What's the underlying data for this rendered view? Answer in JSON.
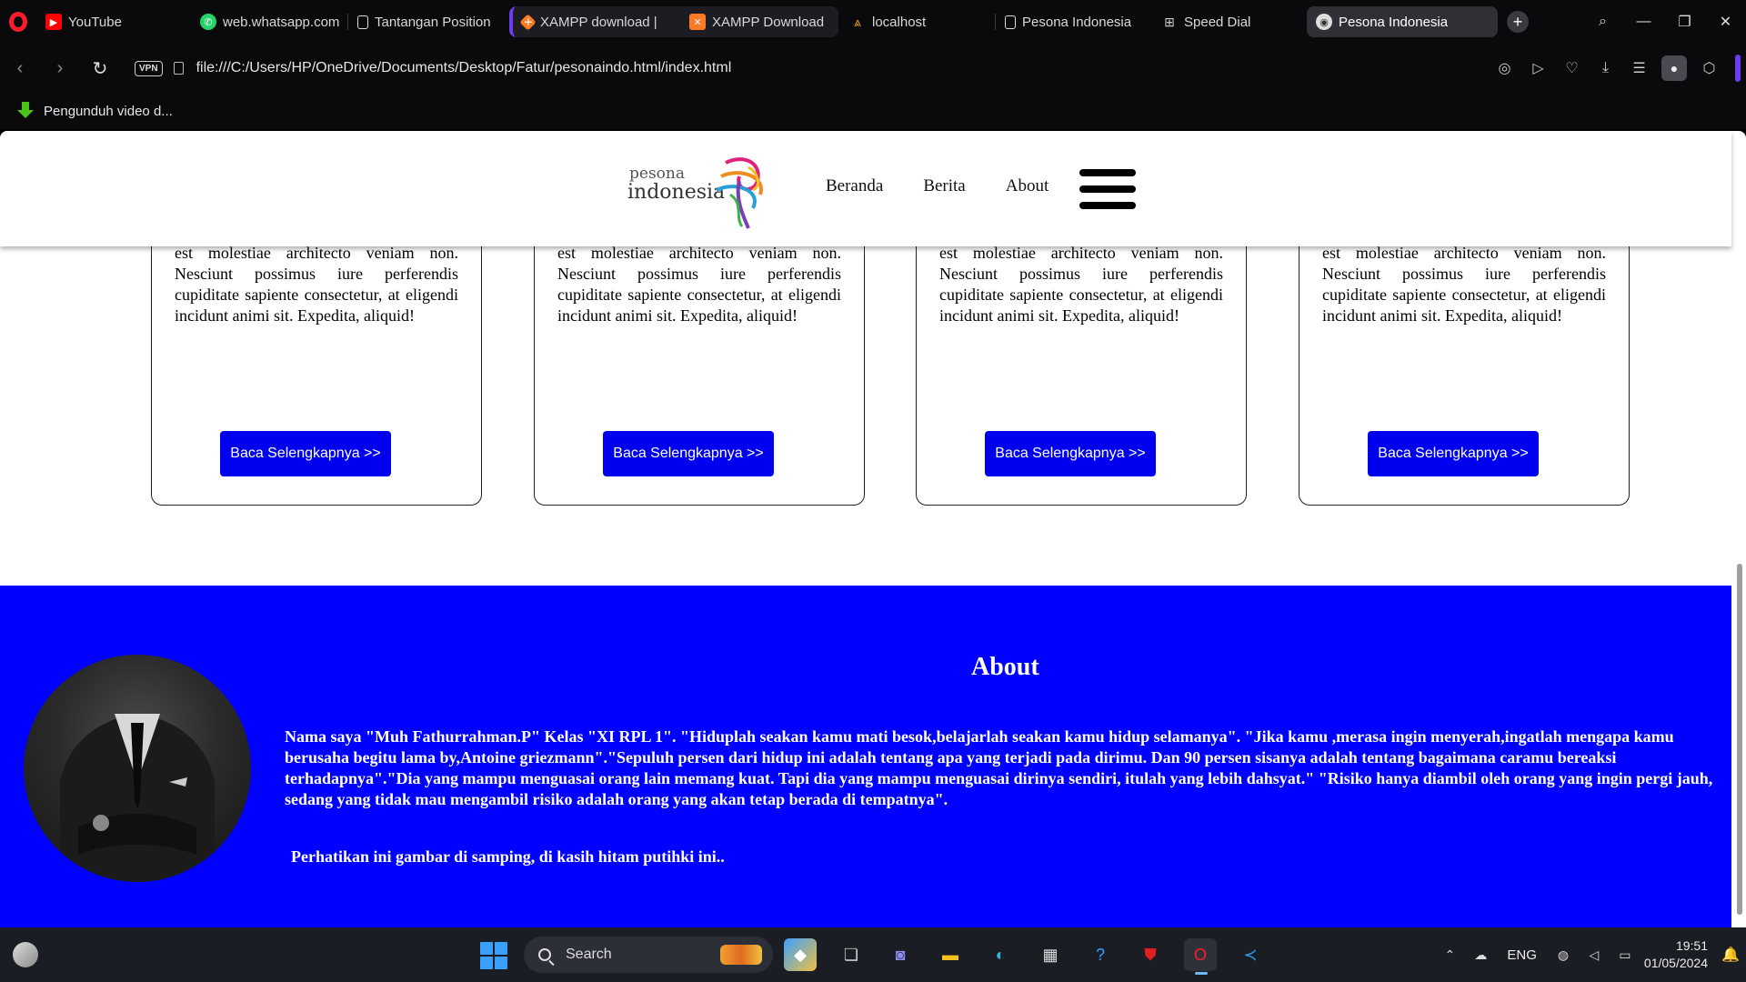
{
  "browser": {
    "tabs": [
      {
        "label": "YouTube",
        "icon": "youtube-icon",
        "color": "#ff0000"
      },
      {
        "label": "web.whatsapp.com",
        "icon": "whatsapp-icon",
        "color": "#25d366"
      },
      {
        "label": "Tantangan Position",
        "icon": "document-icon",
        "color": "#ffffff"
      },
      {
        "label": "XAMPP download |",
        "icon": "xampp-icon",
        "color": "#fb7a24"
      },
      {
        "label": "XAMPP Download",
        "icon": "xampp-icon",
        "color": "#fb7a24"
      },
      {
        "label": "localhost",
        "icon": "localhost-icon",
        "color": "#f0a030"
      },
      {
        "label": "Pesona Indonesia",
        "icon": "document-icon",
        "color": "#ffffff"
      },
      {
        "label": "Speed Dial",
        "icon": "speed-dial-icon",
        "color": "#cccccc"
      },
      {
        "label": "Pesona Indonesia",
        "icon": "globe-icon",
        "color": "#ffffff"
      }
    ],
    "active_tab_index": 8,
    "url": "file:///C:/Users/HP/OneDrive/Documents/Desktop/Fatur/pesonaindo.html/index.html",
    "vpn_label": "VPN",
    "bookmark_label": "Pengunduh video d..."
  },
  "site": {
    "logo_small": "pesona",
    "logo_big": "indonesia",
    "nav": [
      "Beranda",
      "Berita",
      "About"
    ],
    "cards": [
      {
        "text": "Lorem ipsum dolor sit amet consectetur adipisicing elit. Consectetur sequi officia est molestiae architecto veniam non. Nesciunt possimus iure perferendis cupiditate sapiente consectetur, at eligendi incidunt animi sit. Expedita, aliquid!",
        "button": "Baca Selengkapnya >>"
      },
      {
        "text": "Lorem ipsum dolor sit amet consectetur adipisicing elit. Consectetur sequi officia est molestiae architecto veniam non. Nesciunt possimus iure perferendis cupiditate sapiente consectetur, at eligendi incidunt animi sit. Expedita, aliquid!",
        "button": "Baca Selengkapnya >>"
      },
      {
        "text": "Lorem ipsum dolor sit amet consectetur adipisicing elit. Consectetur sequi officia est molestiae architecto veniam non. Nesciunt possimus iure perferendis cupiditate sapiente consectetur, at eligendi incidunt animi sit. Expedita, aliquid!",
        "button": "Baca Selengkapnya >>"
      },
      {
        "text": "Lorem ipsum dolor sit amet consectetur adipisicing elit. Consectetur sequi officia est molestiae architecto veniam non. Nesciunt possimus iure perferendis cupiditate sapiente consectetur, at eligendi incidunt animi sit. Expedita, aliquid!",
        "button": "Baca Selengkapnya >>"
      }
    ],
    "about": {
      "title": "About",
      "text": "Nama saya \"Muh Fathurrahman.P\" Kelas \"XI RPL 1\". \"Hiduplah seakan kamu mati besok,belajarlah seakan kamu hidup selamanya\". \"Jika kamu ,merasa ingin menyerah,ingatlah mengapa kamu berusaha begitu lama by,Antoine griezmann\".\"Sepuluh persen dari hidup ini adalah tentang apa yang terjadi pada dirimu. Dan 90 persen sisanya adalah tentang bagaimana caramu bereaksi terhadapnya\".\"Dia yang mampu menguasai orang lain memang kuat. Tapi dia yang mampu menguasai dirinya sendiri, itulah yang lebih dahsyat.\" \"Risiko hanya diambil oleh orang yang ingin pergi jauh, sedang yang tidak mau mengambil risiko adalah orang yang akan tetap berada di tempatnya\".",
      "note": "Perhatikan ini gambar di samping, di kasih hitam putihki ini..",
      "background_color": "#0000ff"
    },
    "button_color": "#0000ee"
  },
  "taskbar": {
    "search_label": "Search",
    "language": "ENG",
    "time": "19:51",
    "date": "01/05/2024",
    "apps": [
      "copilot-icon",
      "task-view-icon",
      "teams-meet-icon",
      "file-explorer-icon",
      "edge-icon",
      "store-icon",
      "help-icon",
      "mcafee-icon",
      "opera-icon",
      "vscode-icon"
    ]
  }
}
